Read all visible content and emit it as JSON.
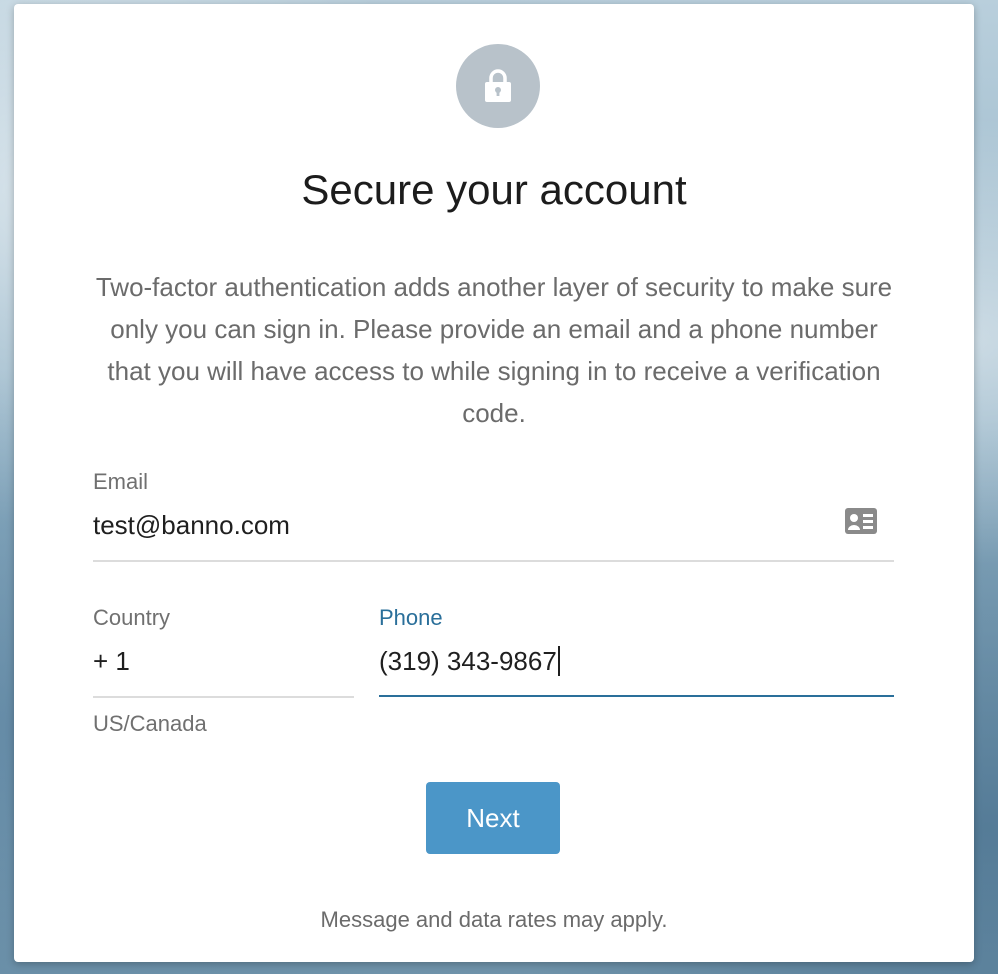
{
  "header": {
    "icon": "lock-icon",
    "title": "Secure your account",
    "description": "Two-factor authentication adds another layer of security to make sure only you can sign in. Please provide an email and a phone number that you will have access to while signing in to receive a verification code."
  },
  "email": {
    "label": "Email",
    "value": "test@banno.com",
    "icon": "contact-card-icon"
  },
  "country": {
    "label": "Country",
    "value": "+ 1",
    "helper": "US/Canada"
  },
  "phone": {
    "label": "Phone",
    "value": "(319) 343-9867"
  },
  "actions": {
    "next_label": "Next"
  },
  "footer": {
    "disclaimer": "Message and data rates may apply."
  },
  "colors": {
    "accent": "#4b96c8",
    "focus": "#2a6f9a",
    "lock_badge": "#b8c2ca"
  }
}
